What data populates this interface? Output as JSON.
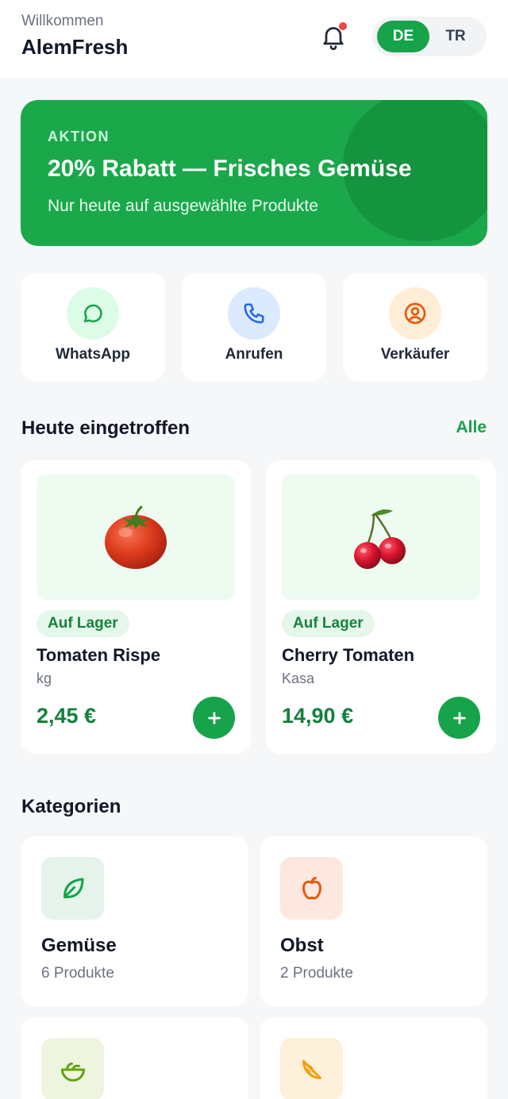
{
  "header": {
    "welcome": "Willkommen",
    "brand": "AlemFresh"
  },
  "languages": [
    {
      "code": "DE",
      "active": true
    },
    {
      "code": "TR",
      "active": false
    }
  ],
  "promo": {
    "tag": "AKTION",
    "title": "20% Rabatt — Frisches Gemüse",
    "subtitle": "Nur heute auf ausgewählte Produkte"
  },
  "actions": [
    {
      "label": "WhatsApp",
      "icon": "chat-bubble-icon"
    },
    {
      "label": "Anrufen",
      "icon": "phone-icon"
    },
    {
      "label": "Verkäufer",
      "icon": "user-circle-icon"
    }
  ],
  "arrivals": {
    "title": "Heute eingetroffen",
    "see_all": "Alle",
    "products": [
      {
        "stock": "Auf Lager",
        "name": "Tomaten Rispe",
        "unit": "kg",
        "price": "2,45 €",
        "image": "tomato"
      },
      {
        "stock": "Auf Lager",
        "name": "Cherry Tomaten",
        "unit": "Kasa",
        "price": "14,90 €",
        "image": "cherry"
      }
    ]
  },
  "categories": {
    "title": "Kategorien",
    "items": [
      {
        "name": "Gemüse",
        "count": "6 Produkte",
        "icon": "leaf-icon"
      },
      {
        "name": "Obst",
        "count": "2 Produkte",
        "icon": "apple-icon"
      },
      {
        "name": "",
        "count": "",
        "icon": "salad-bowl-icon"
      },
      {
        "name": "",
        "count": "",
        "icon": "citrus-slice-icon"
      }
    ]
  },
  "colors": {
    "accent": "#16a34a",
    "promo": "#1aa84b",
    "price": "#15803d",
    "notification": "#ef4444"
  }
}
